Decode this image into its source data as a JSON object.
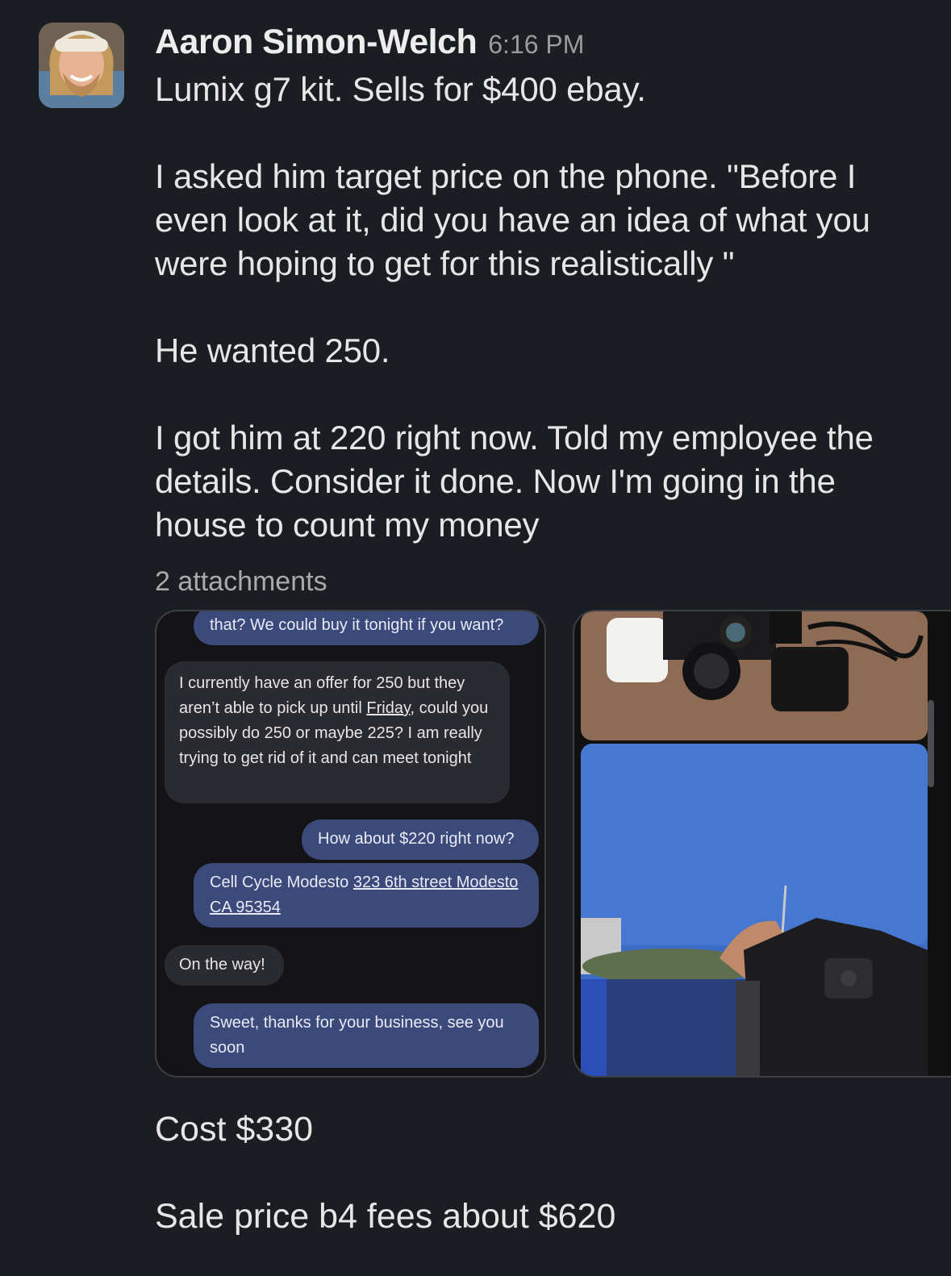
{
  "message": {
    "author": "Aaron Simon-Welch",
    "time": "6:16 PM",
    "paragraphs": [
      "Lumix g7 kit. Sells for $400 ebay.",
      "I asked him target price on the phone. \"Before I even look at it, did you have an idea of what you were hoping to get for this realistically \"",
      "He wanted 250.",
      "I got him at 220 right now. Told my employee the details. Consider it done. Now I'm going in the house to count my money"
    ],
    "attachments_label": "2 attachments",
    "followups": [
      "Cost $330",
      "Sale price b4 fees about $620"
    ]
  },
  "attachment1": {
    "bubbles": {
      "b1": "that? We could buy it tonight if you want?",
      "b2_pre": "I currently have an offer for 250 but they aren’t able to pick up until ",
      "b2_link": "Friday,",
      "b2_post": " could you possibly do 250 or maybe 225? I am really trying to get rid of it and can meet tonight",
      "b3": "How about $220 right now?",
      "b4_pre": "Cell Cycle Modesto ",
      "b4_link": "323 6th street Modesto CA 95354",
      "b5": "On the way!",
      "b6": "Sweet, thanks for your business, see you soon"
    }
  },
  "colors": {
    "background": "#1a1d21",
    "outgoing_bubble": "#3b4a7a",
    "incoming_bubble": "#2a2b30"
  }
}
